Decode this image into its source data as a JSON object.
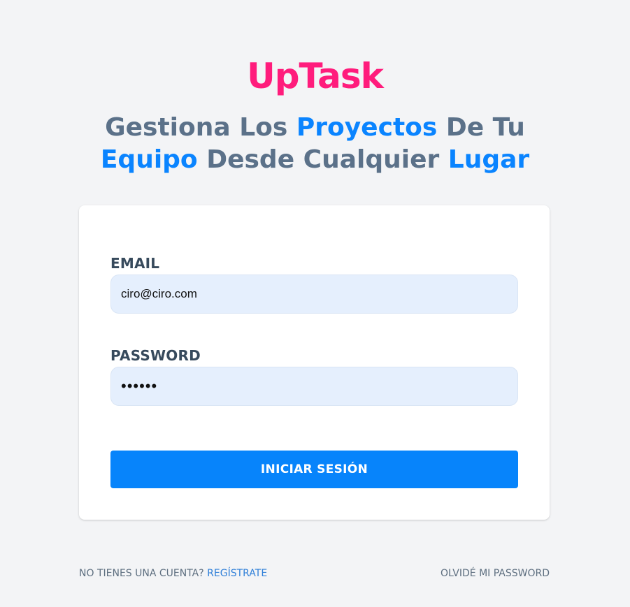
{
  "brand": {
    "name": "UpTask",
    "color": "#ff1c7c"
  },
  "headline": {
    "part1": "Gestiona Los ",
    "highlight1": "Proyectos",
    "part2": " De Tu ",
    "highlight2": "Equipo",
    "part3": " Desde Cualquier ",
    "highlight3": "Lugar",
    "text_color": "#5b7189",
    "highlight_color": "#0a84ff"
  },
  "login_form": {
    "email_label": "EMAIL",
    "email_value": "ciro@ciro.com",
    "password_label": "PASSWORD",
    "password_value": "••••••",
    "submit_label": "INICIAR SESIÓN",
    "submit_color": "#0784fb"
  },
  "footer": {
    "no_account_text": "NO TIENES UNA CUENTA? ",
    "register_link": "REGÍSTRATE",
    "forgot_link": "OLVIDÉ MI PASSWORD"
  }
}
